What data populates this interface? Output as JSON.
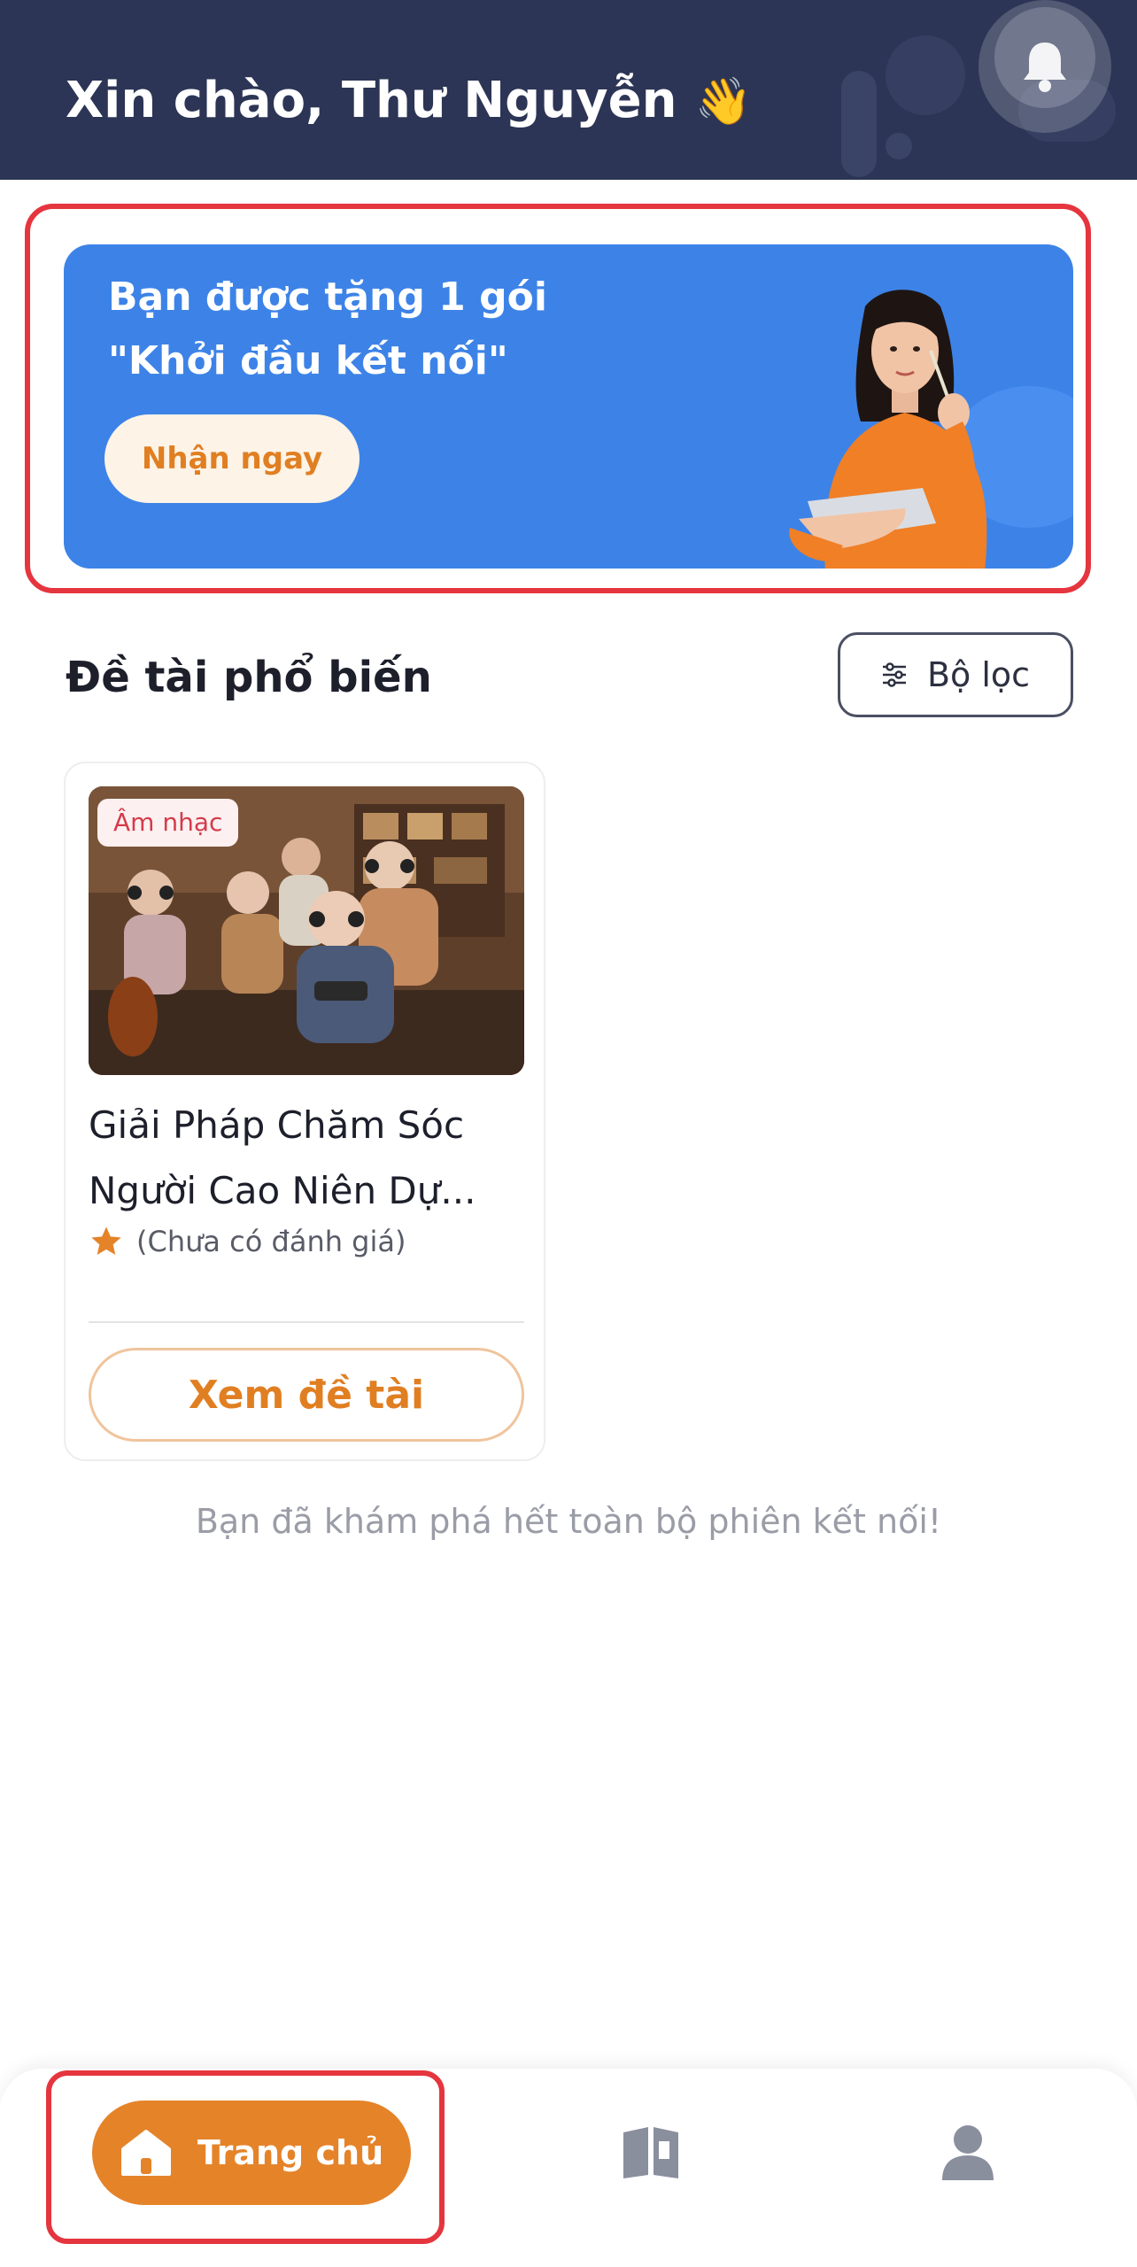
{
  "header": {
    "greeting": "Xin chào, Thư Nguyễn",
    "emoji": "👋",
    "bell_icon": "bell-icon"
  },
  "banner": {
    "line1": "Bạn được tặng 1 gói",
    "line2": "\"Khởi đầu kết nối\"",
    "cta_label": "Nhận ngay"
  },
  "section": {
    "title": "Đề tài phổ biến",
    "filter_label": "Bộ lọc",
    "filter_icon": "sliders-icon"
  },
  "topics": [
    {
      "tag": "Âm nhạc",
      "title_line1": "Giải Pháp Chăm Sóc",
      "title_line2": "Người Cao Niên Dự...",
      "rating_text": "(Chưa có đánh giá)",
      "button_label": "Xem đề tài"
    }
  ],
  "end_message": "Bạn đã khám phá hết toàn bộ phiên kết nối!",
  "bottom_nav": {
    "home_label": "Trang chủ",
    "items": [
      "home-icon",
      "book-icon",
      "user-icon"
    ]
  },
  "colors": {
    "header_bg": "#2c3555",
    "banner_bg": "#3d83e7",
    "accent_orange": "#e58329",
    "annotation_red": "#e5353e"
  }
}
